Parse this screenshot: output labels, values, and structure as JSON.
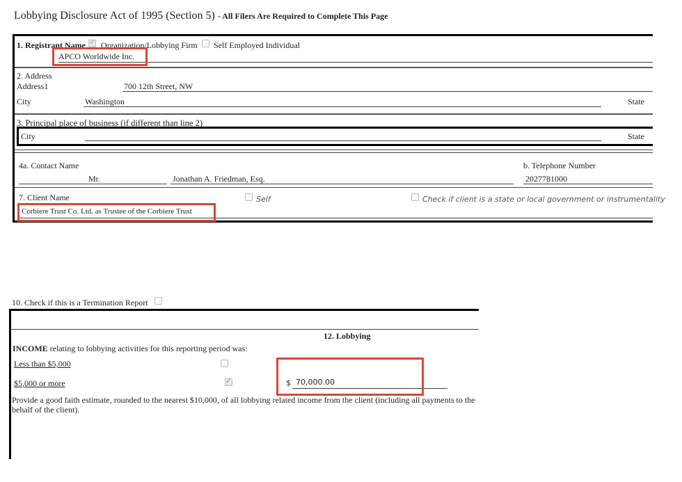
{
  "header": {
    "title": "Lobbying Disclosure Act of 1995 (Section 5)",
    "subtitle": "- All Filers Are Required to Complete This Page"
  },
  "registrant": {
    "label": "1. Registrant Name",
    "org_option": "Organization/Lobbying Firm",
    "org_checked": true,
    "self_option": "Self Employed Individual",
    "self_checked": false,
    "name": "APCO Worldwide Inc."
  },
  "address": {
    "label": "2. Address",
    "address1_label": "Address1",
    "address1": "700 12th Street, NW",
    "city_label": "City",
    "city": "Washington",
    "state_label": "State"
  },
  "principal": {
    "label": "3. Principal place of business (if different than line 2)",
    "city_label": "City",
    "state_label": "State"
  },
  "contact": {
    "label": "4a. Contact Name",
    "prefix": "Mr.",
    "name": "Jonathan A. Friedman, Esq.",
    "phone_label": "b. Telephone Number",
    "phone": "2027781000"
  },
  "client": {
    "label": "7. Client Name",
    "name": "Corbiere Trust Co. Ltd. as Trustee of the Corbiere Trust",
    "self_label": "Self",
    "self_checked": false,
    "state_label": "Check if client is a state or local government or instrumentality",
    "state_checked": false
  },
  "termination": {
    "label": "10. Check if this is a Termination Report",
    "checked": false
  },
  "lobbying": {
    "heading": "12. Lobbying",
    "income_bold": "INCOME",
    "income_rest": "relating to lobbying activities for this reporting period was:",
    "less_label": "Less than $5,000",
    "less_checked": false,
    "more_label": "$5,000 or more",
    "more_checked": true,
    "currency": "$",
    "amount": "70,000.00",
    "note_line1": "Provide a good faith estimate, rounded to the nearest $10,000, of all lobbying related income from the client (including all payments to the",
    "note_line2": "behalf of the client)."
  },
  "colors": {
    "highlight": "#d9463b"
  }
}
